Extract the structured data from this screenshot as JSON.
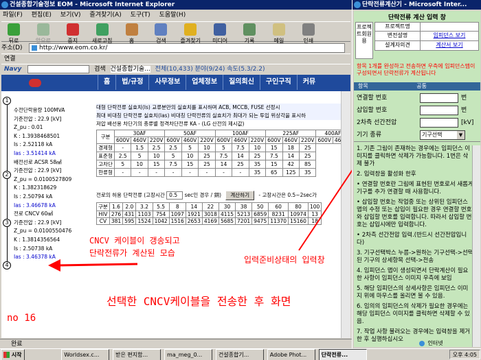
{
  "browser": {
    "title": "건설종합기술정보 EOM - Microsoft Internet Explorer",
    "menus": [
      "파일(F)",
      "편집(E)",
      "보기(V)",
      "즐겨찾기(A)",
      "도구(T)",
      "도움말(H)"
    ],
    "toolbar": [
      "뒤로",
      "앞으로",
      "중지",
      "새로고침",
      "홈",
      "검색",
      "즐겨찾기",
      "미디어",
      "기록",
      "메일",
      "인쇄"
    ],
    "address_label": "주소(D)",
    "url": "http://www.eom.co.kr/",
    "links_label": "연결",
    "navy_label": "Navy",
    "navy_search": "검색",
    "navy_query": "건설종합기술...",
    "navy_stats": "전체(10,433)  분야(9/24)  속도(5.3/2.2)",
    "status_done": "완료",
    "status_zone": "인터넷"
  },
  "site_nav": [
    "홈",
    "법/규정",
    "사무정보",
    "업체정보",
    "질의회신",
    "구인구직",
    "커뮤"
  ],
  "diagram": {
    "nodes": [
      "1",
      "2",
      "3",
      "4"
    ],
    "lines": [
      {
        "text": "수전단락용량 100MVA",
        "color": "#000"
      },
      {
        "text": "기준전압 : 22.9 [kV]",
        "color": "#000"
      },
      {
        "text": "Z_pu : 0.01",
        "color": "#000"
      },
      {
        "text": "K : 1.3938468501",
        "color": "#000"
      },
      {
        "text": "Is : 2.52118 kA",
        "color": "#000"
      },
      {
        "text": "Ias : 3.51414 kA",
        "color": "#0000cc"
      },
      {
        "text": "배전선로 ACSR 58㎟",
        "color": "#000"
      },
      {
        "text": "기준전압 : 22.9 [kV]",
        "color": "#000"
      },
      {
        "text": "Z_pu = 0.0100527809",
        "color": "#000"
      },
      {
        "text": "K : 1.382318629",
        "color": "#000"
      },
      {
        "text": "Is : 2.50794 kA",
        "color": "#000"
      },
      {
        "text": "Ias : 3.46678 kA",
        "color": "#0000cc"
      },
      {
        "text": "전로 CNCV 60㎟",
        "color": "#000"
      },
      {
        "text": "기준전압 : 22.9 [kV]",
        "color": "#000"
      },
      {
        "text": "Z_pu = 0.0100550476",
        "color": "#000"
      },
      {
        "text": "K : 1.3814356564",
        "color": "#000"
      },
      {
        "text": "Is : 2.50738 kA",
        "color": "#000"
      },
      {
        "text": "Ias : 3.46378 kA",
        "color": "#0000cc"
      }
    ]
  },
  "info": {
    "line1": "대형 단락전류 실효치(Is)  교류분만의 실효치를 표시하며 ACB, MCCB, FUSE 선정시",
    "line2": "최대 비대칭 단락전류 실효치(Ias)  비대칭 단락전류의 실효치가 최대가 되는 투입 위상각을 표시하",
    "line3": "저압 배선용 차단기의 종류별 정격차단전류 KA - (LG 산전의 제시값)"
  },
  "breaker_table": {
    "groups": [
      "구분",
      "30AF",
      "50AF",
      "100AF",
      "225AF",
      "400AF"
    ],
    "subheads": [
      "600V",
      "460V",
      "220V",
      "600V",
      "460V",
      "220V",
      "600V",
      "460V",
      "220V",
      "600V",
      "460V",
      "220V",
      "600V",
      "460V"
    ],
    "rows": [
      [
        "경제형",
        "-",
        "1.5",
        "2.5",
        "2.5",
        "5",
        "10",
        "5",
        "7.5",
        "10",
        "15",
        "18",
        "25"
      ],
      [
        "표준형",
        "2.5",
        "5",
        "10",
        "5",
        "10",
        "25",
        "7.5",
        "14",
        "25",
        "7.5",
        "14",
        "25"
      ],
      [
        "고차단",
        "5",
        "10",
        "15",
        "7.5",
        "15",
        "25",
        "14",
        "25",
        "35",
        "15",
        "42",
        "85"
      ],
      [
        "한류형",
        "-",
        "-",
        "-",
        "-",
        "-",
        "-",
        "-",
        "-",
        "35",
        "65",
        "125",
        "35"
      ]
    ]
  },
  "allow_table": {
    "label": "전로의 허용 단락전류 (고장시간",
    "value": "0.5",
    "suffix": "sec인 경우 / 銅)",
    "button": "계산하기",
    "note": "- 고장시간은 0.5~2sec가",
    "head": [
      "구분",
      "1.6",
      "2.0",
      "3.2",
      "5.5",
      "8",
      "14",
      "22",
      "30",
      "38",
      "50",
      "60",
      "80",
      "100"
    ],
    "rows": [
      [
        "HIV",
        "276",
        "431",
        "1103",
        "754",
        "1097",
        "1921",
        "3018",
        "4115",
        "5213",
        "6859",
        "8231",
        "10974",
        "13"
      ],
      [
        "CV",
        "381",
        "595",
        "1524",
        "1042",
        "1516",
        "2653",
        "4169",
        "5685",
        "7201",
        "9475",
        "11370",
        "15160",
        "18"
      ]
    ]
  },
  "annotations": {
    "cable_line1": "CNCV 케이블이 갱송되고",
    "cable_line2": "단락전류가 계산된 모습",
    "input_ready": "입력준비상태의 입력창",
    "result": "선택한 CNCV케이블을 전송한 후 화면",
    "no": "no 16"
  },
  "calc": {
    "title": "단락전류계산기 - Microsoft Inter...",
    "heading": "단락전류 계산 입력 창",
    "side_label": "프로젝트회원용",
    "rows": [
      {
        "label": "프로젝트명",
        "value": ""
      },
      {
        "label": "변전설명",
        "value": "임피던스 보기"
      },
      {
        "label": "설계자의견",
        "value": "계산서 보기"
      }
    ],
    "warning": "항목 1개를 완성하고 전송하면 우측에 임피던스맵이 구성되면서 단락전류가 계산됩니다",
    "tab_left": "항목",
    "tab_right": "공통",
    "fields": [
      {
        "label": "연결할 번호",
        "unit": "번"
      },
      {
        "label": "삽입할 번호",
        "unit": "번"
      },
      {
        "label": "2차측 선간전압",
        "unit": "[kV]"
      },
      {
        "label": "기기 종류",
        "unit": ""
      }
    ],
    "select_value": "기구선택",
    "notes": [
      "1. 기존 그림이 존재하는 경우에는 임피던스 이미지를 클릭하면 삭제가 가능합니다. 1번은 삭제 불가",
      "2. 입력창을 활성화 한후",
      "• 연결할 번호란 그림에 표현된 번호로서 새롭게 기구를 추가 연결할 때 사용합니다.",
      "• 삽입할 번호는 작업중 또는 상위된 임피던스 맵의 수정 또는 삽입이 필요한 경우 연결할 번호와 삽입할 번호를 입력합니다. 따라서 삽입할 번호는 삽입시에만 입력합니다.",
      "• 2차측 선간전압 입력.(반드시 선간전압입니다)",
      "3. 기구선택박스 누름->원하는 기구선택->선택된 기구의 상세항목 선택->전송",
      "4. 임피던스 맵이 생성되면서 단락계산이 필요한 사항이 임피던스 이미지 우측에 보임",
      "5. 해당 임피던스의 상세사항은 임피던스 이미지 위에 마우스를 올리면 볼 수 있음.",
      "6. 임의의 임피던스의 삭제가 필요한 경우에는 해당 임피던스 이미지를 클릭하면 삭제할 수 있음.",
      "7. 작업 사항 불러오는 경우에는 입력창을 제거한 후 실행하십시오"
    ]
  },
  "taskbar": {
    "start": "시작",
    "tasks": [
      "Worldsex.c...",
      "받은 편지함...",
      "ma_meg_0...",
      "건설종합기...",
      "Adobe Phot...",
      "단락전류..."
    ],
    "clock": "오후 4:05"
  },
  "colors": {
    "titlebar": "#0a246a",
    "site_nav": "#1f4a9c",
    "annotation_red": "#ff0000",
    "calc_bg": "#c6e6bc"
  }
}
